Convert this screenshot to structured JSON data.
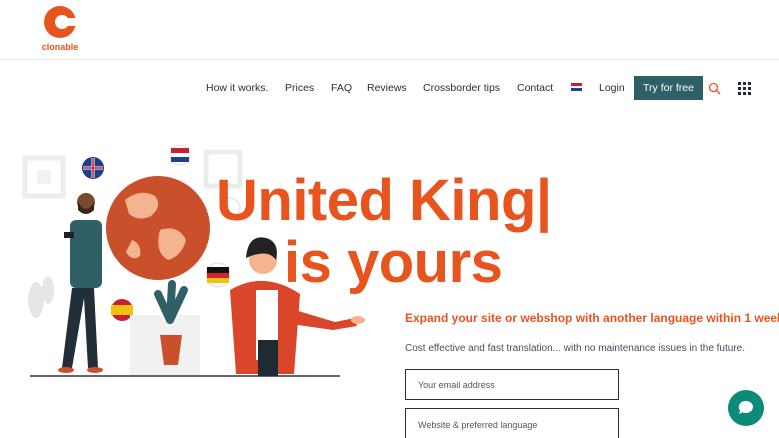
{
  "brand": {
    "logo_text": "clonable",
    "color": "#e8541e"
  },
  "nav": {
    "items": [
      {
        "label": "How it works."
      },
      {
        "label": "Prices"
      },
      {
        "label": "FAQ"
      },
      {
        "label": "Reviews"
      },
      {
        "label": "Crossborder tips"
      },
      {
        "label": "Contact"
      }
    ],
    "language_flag": "netherlands-flag-icon",
    "login_label": "Login",
    "try_label": "Try for free",
    "try_color": "#2f5f67"
  },
  "hero": {
    "headline_line1": "United King|",
    "headline_line2": "is yours",
    "subheading": "Expand your site or webshop with another language within 1 week?",
    "description": "Cost effective and fast translation... with no maintenance issues in the future."
  },
  "form": {
    "email_placeholder": "Your email address",
    "website_placeholder": "Website & preferred language"
  },
  "chat": {
    "icon": "chat-bubble-icon",
    "color": "#0d8a7a"
  }
}
